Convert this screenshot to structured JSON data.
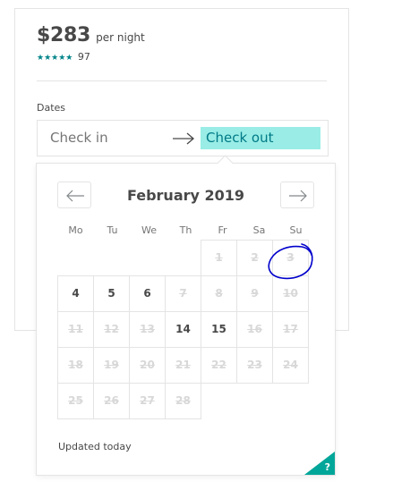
{
  "listing": {
    "price": "$283",
    "per_night": "per night",
    "stars": "★★★★★",
    "review_count": "97",
    "rating_value": 5,
    "star_color": "#008489"
  },
  "dates": {
    "label": "Dates",
    "check_in_placeholder": "Check in",
    "check_out_placeholder": "Check out",
    "active_field": "check_out",
    "active_highlight_color": "#99ede6"
  },
  "calendar": {
    "month_title": "February 2019",
    "prev_icon": "arrow-left-icon",
    "next_icon": "arrow-right-icon",
    "weekdays": [
      "Mo",
      "Tu",
      "We",
      "Th",
      "Fr",
      "Sa",
      "Su"
    ],
    "days": [
      {
        "label": "1",
        "state": "blocked",
        "weekday": 4,
        "week": 0
      },
      {
        "label": "2",
        "state": "blocked",
        "weekday": 5,
        "week": 0
      },
      {
        "label": "3",
        "state": "blocked",
        "weekday": 6,
        "week": 0
      },
      {
        "label": "4",
        "state": "available",
        "weekday": 0,
        "week": 1
      },
      {
        "label": "5",
        "state": "available",
        "weekday": 1,
        "week": 1
      },
      {
        "label": "6",
        "state": "available",
        "weekday": 2,
        "week": 1
      },
      {
        "label": "7",
        "state": "blocked",
        "weekday": 3,
        "week": 1
      },
      {
        "label": "8",
        "state": "blocked",
        "weekday": 4,
        "week": 1
      },
      {
        "label": "9",
        "state": "blocked",
        "weekday": 5,
        "week": 1
      },
      {
        "label": "10",
        "state": "blocked",
        "weekday": 6,
        "week": 1
      },
      {
        "label": "11",
        "state": "blocked",
        "weekday": 0,
        "week": 2
      },
      {
        "label": "12",
        "state": "blocked",
        "weekday": 1,
        "week": 2
      },
      {
        "label": "13",
        "state": "blocked",
        "weekday": 2,
        "week": 2
      },
      {
        "label": "14",
        "state": "available",
        "weekday": 3,
        "week": 2
      },
      {
        "label": "15",
        "state": "available",
        "weekday": 4,
        "week": 2
      },
      {
        "label": "16",
        "state": "blocked",
        "weekday": 5,
        "week": 2
      },
      {
        "label": "17",
        "state": "blocked",
        "weekday": 6,
        "week": 2
      },
      {
        "label": "18",
        "state": "blocked",
        "weekday": 0,
        "week": 3
      },
      {
        "label": "19",
        "state": "blocked",
        "weekday": 1,
        "week": 3
      },
      {
        "label": "20",
        "state": "blocked",
        "weekday": 2,
        "week": 3
      },
      {
        "label": "21",
        "state": "blocked",
        "weekday": 3,
        "week": 3
      },
      {
        "label": "22",
        "state": "blocked",
        "weekday": 4,
        "week": 3
      },
      {
        "label": "23",
        "state": "blocked",
        "weekday": 5,
        "week": 3
      },
      {
        "label": "24",
        "state": "blocked",
        "weekday": 6,
        "week": 3
      },
      {
        "label": "25",
        "state": "blocked",
        "weekday": 0,
        "week": 4
      },
      {
        "label": "26",
        "state": "blocked",
        "weekday": 1,
        "week": 4
      },
      {
        "label": "27",
        "state": "blocked",
        "weekday": 2,
        "week": 4
      },
      {
        "label": "28",
        "state": "blocked",
        "weekday": 3,
        "week": 4
      }
    ],
    "annotation": {
      "type": "hand-drawn-circle",
      "target_day": "3",
      "color": "#0000cc"
    },
    "footer_text": "Updated today",
    "help_label": "?",
    "help_color": "#00a699"
  },
  "colors": {
    "text": "#484848",
    "muted_text": "#757575",
    "blocked_text": "#d8d8d8",
    "border": "#e4e4e4",
    "active_text": "#007a87"
  }
}
